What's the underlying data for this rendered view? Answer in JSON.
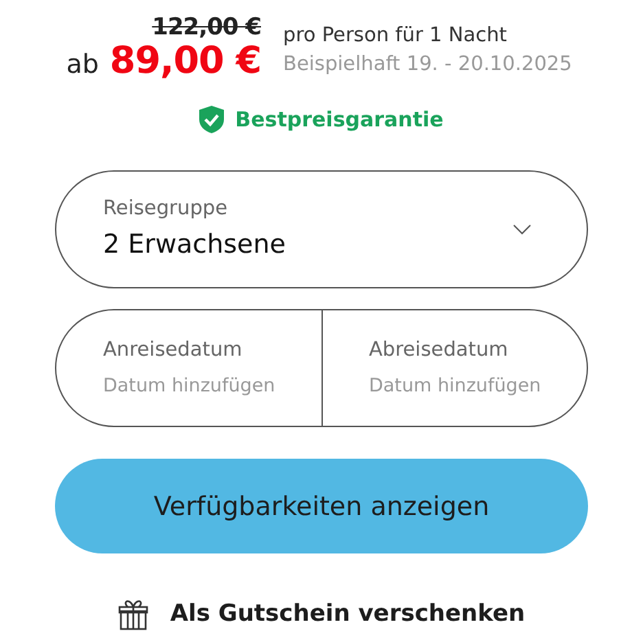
{
  "price": {
    "old": "122,00 €",
    "prefix": "ab",
    "current": "89,00 €",
    "per": "pro Person für 1 Nacht",
    "example": "Beispielhaft 19. - 20.10.2025"
  },
  "badge": {
    "label": "Bestpreisgarantie"
  },
  "group_select": {
    "label": "Reisegruppe",
    "value": "2 Erwachsene"
  },
  "dates": [
    {
      "label": "Anreisedatum",
      "placeholder": "Datum hinzufügen"
    },
    {
      "label": "Abreisedatum",
      "placeholder": "Datum hinzufügen"
    }
  ],
  "submit": {
    "label": "Verfügbarkeiten anzeigen"
  },
  "gift_link": {
    "label": "Als Gutschein verschenken"
  }
}
